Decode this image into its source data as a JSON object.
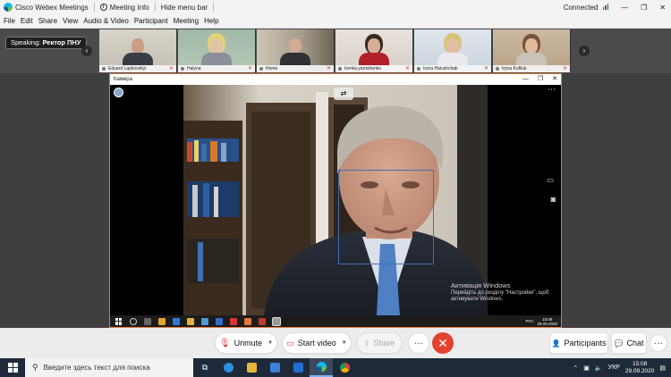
{
  "titlebar": {
    "app_name": "Cisco Webex Meetings",
    "meeting_info": "Meeting Info",
    "hide_menu_bar": "Hide menu bar",
    "connection_status": "Connected"
  },
  "menu": [
    "File",
    "Edit",
    "Share",
    "View",
    "Audio & Video",
    "Participant",
    "Meeting",
    "Help"
  ],
  "speaking": {
    "label": "Speaking:",
    "name": "Ректор ПНУ"
  },
  "participants": [
    {
      "name": "Eduard Lapkovskyi"
    },
    {
      "name": "Halyna"
    },
    {
      "name": "Home"
    },
    {
      "name": "Irenka.yaroshenko"
    },
    {
      "name": "Iryna Haiushchak"
    },
    {
      "name": "Iryna Kufliuk"
    }
  ],
  "camera_window": {
    "title": "Камера",
    "activation_title": "Активація Windows",
    "activation_text": "Перейдіть до розділу \"Настройки\", щоб активувати Windows.",
    "tray_lang": "РУС",
    "tray_time": "15:08",
    "tray_date": "29.09.2020"
  },
  "controls": {
    "unmute": "Unmute",
    "start_video": "Start video",
    "share": "Share",
    "more": "···",
    "leave": "✕",
    "participants": "Participants",
    "chat": "Chat",
    "bottom_more": "···"
  },
  "taskbar": {
    "search_placeholder": "Введите здесь текст для поиска",
    "lang": "УКР",
    "time": "15:08",
    "date": "29.09.2020"
  },
  "colors": {
    "leave_red": "#e2422f",
    "camera_border": "#e07a3a",
    "accent_blue": "#3f6fb5"
  }
}
